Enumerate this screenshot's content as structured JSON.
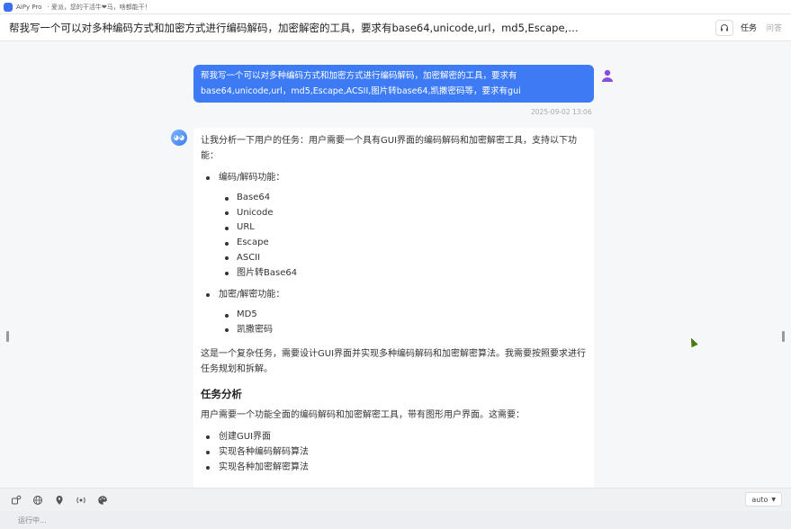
{
  "window": {
    "app_name": "AiPy Pro",
    "status_text": "· 爱派，您的干活牛❤马，啥都能干！"
  },
  "header": {
    "title": "帮我写一个可以对多种编码方式和加密方式进行编码解码，加密解密的工具，要求有base64,unicode,url，md5,Escape,ACSII,图片转ba...",
    "tab_task": "任务",
    "tab_ask": "问答"
  },
  "user_message": {
    "line1": "帮我写一个可以对多种编码方式和加密方式进行编码解码，加密解密的工具，要求有",
    "line2": "base64,unicode,url，md5,Escape,ACSII,图片转base64,凯撒密码等，要求有gui",
    "time": "2025-09-02 13:06"
  },
  "assistant_message": {
    "intro": "让我分析一下用户的任务：用户需要一个具有GUI界面的编码解码和加密解密工具，支持以下功能：",
    "group1_title": "编码/解码功能：",
    "group1_items": [
      "Base64",
      "Unicode",
      "URL",
      "Escape",
      "ASCII",
      "图片转Base64"
    ],
    "group2_title": "加密/解密功能：",
    "group2_items": [
      "MD5",
      "凯撒密码"
    ],
    "summary": "这是一个复杂任务，需要设计GUI界面并实现多种编码解码和加密解密算法。我需要按照要求进行任务规划和拆解。",
    "section_heading": "任务分析",
    "section_intro": "用户需要一个功能全面的编码解码和加密解密工具，带有图形用户界面。这需要：",
    "section_items": [
      "创建GUI界面",
      "实现各种编码解码算法",
      "实现各种加密解密算法"
    ]
  },
  "toolbar": {
    "icons": [
      "plugin-icon",
      "globe-icon",
      "location-icon",
      "network-icon",
      "palette-icon"
    ],
    "mode_value": "auto"
  },
  "statusbar": {
    "text": "运行中..."
  },
  "colors": {
    "accent": "#3d7bf5",
    "user_avatar": "#8a4fd8"
  }
}
